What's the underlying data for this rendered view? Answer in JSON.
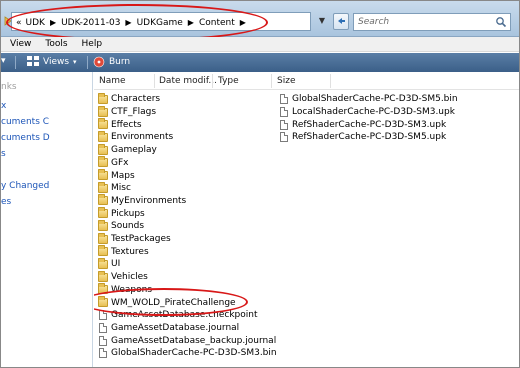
{
  "address": {
    "nav_arrow": "«",
    "crumbs": [
      "UDK",
      "UDK-2011-03",
      "UDKGame",
      "Content"
    ],
    "search_placeholder": "Search"
  },
  "menu": [
    "View",
    "Tools",
    "Help"
  ],
  "toolbar": {
    "views_label": "Views",
    "burn_label": "Burn"
  },
  "nav_pane": {
    "items": [
      "nks",
      "x",
      "cuments C",
      "cuments D",
      "s",
      "y Changed",
      "es"
    ]
  },
  "columns": {
    "name": "Name",
    "date": "Date modif...",
    "type": "Type",
    "size": "Size"
  },
  "folders": [
    "Characters",
    "CTF_Flags",
    "Effects",
    "Environments",
    "Gameplay",
    "GFx",
    "Maps",
    "Misc",
    "MyEnvironments",
    "Pickups",
    "Sounds",
    "TestPackages",
    "Textures",
    "UI",
    "Vehicles",
    "Weapons",
    "WM_WOLD_PirateChallenge"
  ],
  "files_left": [
    "GameAssetDatabase.checkpoint",
    "GameAssetDatabase.journal",
    "GameAssetDatabase_backup.journal",
    "GlobalShaderCache-PC-D3D-SM3.bin"
  ],
  "files_right": [
    "GlobalShaderCache-PC-D3D-SM5.bin",
    "LocalShaderCache-PC-D3D-SM3.upk",
    "RefShaderCache-PC-D3D-SM3.upk",
    "RefShaderCache-PC-D3D-SM5.upk"
  ],
  "colors": {
    "highlight_oval": "#d81818",
    "toolbar": "#3b5f88",
    "link": "#1e56b8"
  }
}
